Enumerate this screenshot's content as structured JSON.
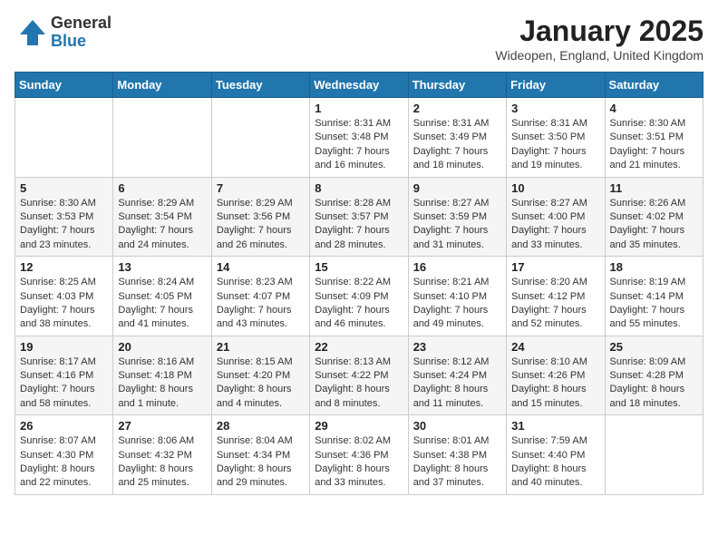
{
  "header": {
    "logo_general": "General",
    "logo_blue": "Blue",
    "month_title": "January 2025",
    "location": "Wideopen, England, United Kingdom"
  },
  "days_of_week": [
    "Sunday",
    "Monday",
    "Tuesday",
    "Wednesday",
    "Thursday",
    "Friday",
    "Saturday"
  ],
  "weeks": [
    [
      {
        "day": "",
        "info": ""
      },
      {
        "day": "",
        "info": ""
      },
      {
        "day": "",
        "info": ""
      },
      {
        "day": "1",
        "info": "Sunrise: 8:31 AM\nSunset: 3:48 PM\nDaylight: 7 hours\nand 16 minutes."
      },
      {
        "day": "2",
        "info": "Sunrise: 8:31 AM\nSunset: 3:49 PM\nDaylight: 7 hours\nand 18 minutes."
      },
      {
        "day": "3",
        "info": "Sunrise: 8:31 AM\nSunset: 3:50 PM\nDaylight: 7 hours\nand 19 minutes."
      },
      {
        "day": "4",
        "info": "Sunrise: 8:30 AM\nSunset: 3:51 PM\nDaylight: 7 hours\nand 21 minutes."
      }
    ],
    [
      {
        "day": "5",
        "info": "Sunrise: 8:30 AM\nSunset: 3:53 PM\nDaylight: 7 hours\nand 23 minutes."
      },
      {
        "day": "6",
        "info": "Sunrise: 8:29 AM\nSunset: 3:54 PM\nDaylight: 7 hours\nand 24 minutes."
      },
      {
        "day": "7",
        "info": "Sunrise: 8:29 AM\nSunset: 3:56 PM\nDaylight: 7 hours\nand 26 minutes."
      },
      {
        "day": "8",
        "info": "Sunrise: 8:28 AM\nSunset: 3:57 PM\nDaylight: 7 hours\nand 28 minutes."
      },
      {
        "day": "9",
        "info": "Sunrise: 8:27 AM\nSunset: 3:59 PM\nDaylight: 7 hours\nand 31 minutes."
      },
      {
        "day": "10",
        "info": "Sunrise: 8:27 AM\nSunset: 4:00 PM\nDaylight: 7 hours\nand 33 minutes."
      },
      {
        "day": "11",
        "info": "Sunrise: 8:26 AM\nSunset: 4:02 PM\nDaylight: 7 hours\nand 35 minutes."
      }
    ],
    [
      {
        "day": "12",
        "info": "Sunrise: 8:25 AM\nSunset: 4:03 PM\nDaylight: 7 hours\nand 38 minutes."
      },
      {
        "day": "13",
        "info": "Sunrise: 8:24 AM\nSunset: 4:05 PM\nDaylight: 7 hours\nand 41 minutes."
      },
      {
        "day": "14",
        "info": "Sunrise: 8:23 AM\nSunset: 4:07 PM\nDaylight: 7 hours\nand 43 minutes."
      },
      {
        "day": "15",
        "info": "Sunrise: 8:22 AM\nSunset: 4:09 PM\nDaylight: 7 hours\nand 46 minutes."
      },
      {
        "day": "16",
        "info": "Sunrise: 8:21 AM\nSunset: 4:10 PM\nDaylight: 7 hours\nand 49 minutes."
      },
      {
        "day": "17",
        "info": "Sunrise: 8:20 AM\nSunset: 4:12 PM\nDaylight: 7 hours\nand 52 minutes."
      },
      {
        "day": "18",
        "info": "Sunrise: 8:19 AM\nSunset: 4:14 PM\nDaylight: 7 hours\nand 55 minutes."
      }
    ],
    [
      {
        "day": "19",
        "info": "Sunrise: 8:17 AM\nSunset: 4:16 PM\nDaylight: 7 hours\nand 58 minutes."
      },
      {
        "day": "20",
        "info": "Sunrise: 8:16 AM\nSunset: 4:18 PM\nDaylight: 8 hours\nand 1 minute."
      },
      {
        "day": "21",
        "info": "Sunrise: 8:15 AM\nSunset: 4:20 PM\nDaylight: 8 hours\nand 4 minutes."
      },
      {
        "day": "22",
        "info": "Sunrise: 8:13 AM\nSunset: 4:22 PM\nDaylight: 8 hours\nand 8 minutes."
      },
      {
        "day": "23",
        "info": "Sunrise: 8:12 AM\nSunset: 4:24 PM\nDaylight: 8 hours\nand 11 minutes."
      },
      {
        "day": "24",
        "info": "Sunrise: 8:10 AM\nSunset: 4:26 PM\nDaylight: 8 hours\nand 15 minutes."
      },
      {
        "day": "25",
        "info": "Sunrise: 8:09 AM\nSunset: 4:28 PM\nDaylight: 8 hours\nand 18 minutes."
      }
    ],
    [
      {
        "day": "26",
        "info": "Sunrise: 8:07 AM\nSunset: 4:30 PM\nDaylight: 8 hours\nand 22 minutes."
      },
      {
        "day": "27",
        "info": "Sunrise: 8:06 AM\nSunset: 4:32 PM\nDaylight: 8 hours\nand 25 minutes."
      },
      {
        "day": "28",
        "info": "Sunrise: 8:04 AM\nSunset: 4:34 PM\nDaylight: 8 hours\nand 29 minutes."
      },
      {
        "day": "29",
        "info": "Sunrise: 8:02 AM\nSunset: 4:36 PM\nDaylight: 8 hours\nand 33 minutes."
      },
      {
        "day": "30",
        "info": "Sunrise: 8:01 AM\nSunset: 4:38 PM\nDaylight: 8 hours\nand 37 minutes."
      },
      {
        "day": "31",
        "info": "Sunrise: 7:59 AM\nSunset: 4:40 PM\nDaylight: 8 hours\nand 40 minutes."
      },
      {
        "day": "",
        "info": ""
      }
    ]
  ]
}
